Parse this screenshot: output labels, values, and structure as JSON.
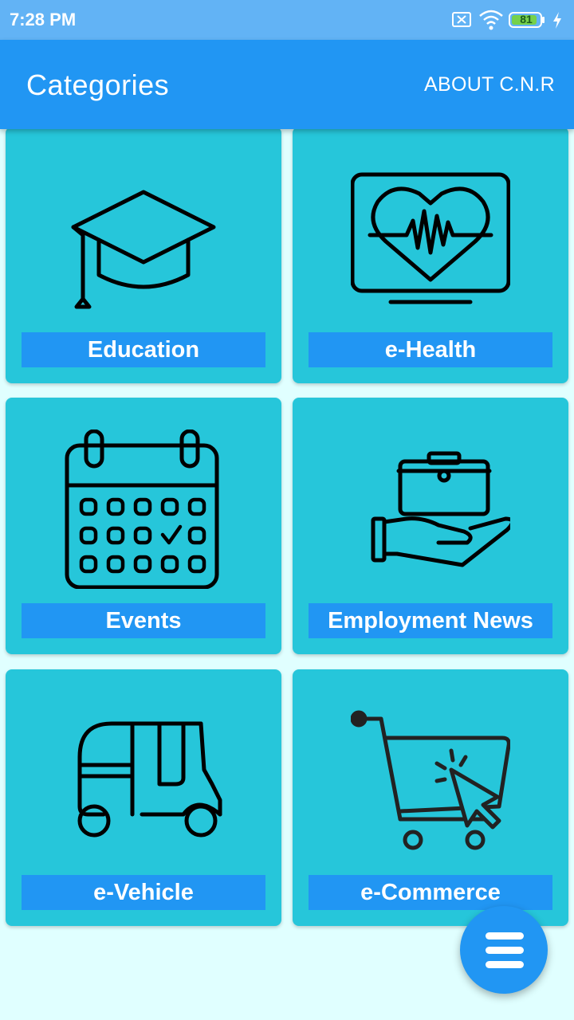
{
  "status_bar": {
    "time": "7:28 PM",
    "battery": "81",
    "icons": [
      "sim-off-icon",
      "wifi-icon",
      "battery-icon",
      "charging-icon"
    ]
  },
  "app_bar": {
    "title": "Categories",
    "about_label": "ABOUT C.N.R"
  },
  "categories": [
    {
      "label": "Education",
      "icon": "graduation-cap-icon"
    },
    {
      "label": "e-Health",
      "icon": "heartbeat-monitor-icon"
    },
    {
      "label": "Events",
      "icon": "calendar-icon"
    },
    {
      "label": "Employment News",
      "icon": "briefcase-hand-icon"
    },
    {
      "label": "e-Vehicle",
      "icon": "auto-rickshaw-icon"
    },
    {
      "label": "e-Commerce",
      "icon": "shopping-cart-icon"
    }
  ],
  "fab": {
    "icon": "menu-icon"
  },
  "colors": {
    "status_bar": "#62b3f5",
    "app_bar": "#2196f3",
    "card": "#26c6da",
    "label_bg": "#2196f3",
    "background": "#e0ffff"
  }
}
